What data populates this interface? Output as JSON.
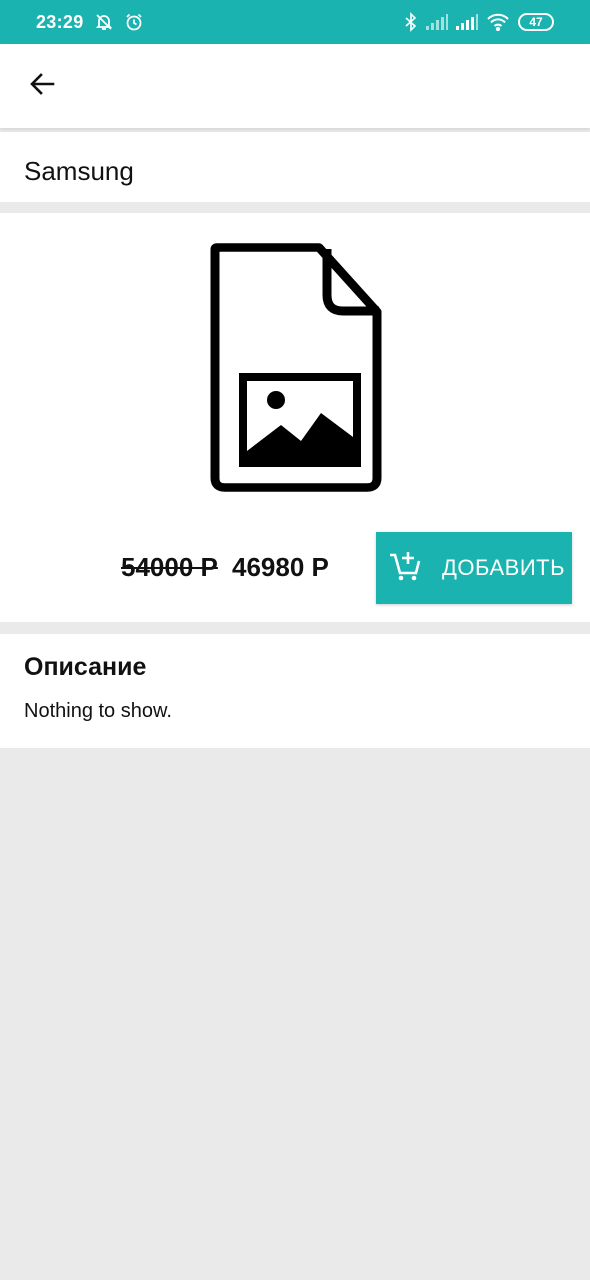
{
  "status_bar": {
    "time": "23:29",
    "battery": "47",
    "background_color": "#1ab3af"
  },
  "app_bar": {
    "back_icon": "arrow-back-icon"
  },
  "product": {
    "title": "Samsung",
    "image_icon": "image-file-placeholder-icon",
    "old_price": "54000 Р",
    "new_price": "46980 Р",
    "add_button_label": "ДОБАВИТЬ",
    "add_button_icon": "add-to-cart-icon",
    "accent_color": "#1ab3af"
  },
  "description": {
    "heading": "Описание",
    "text": "Nothing to show."
  }
}
